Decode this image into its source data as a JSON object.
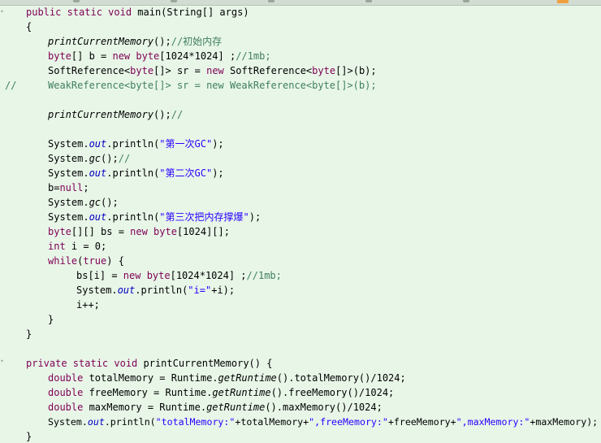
{
  "lines": [
    {
      "text": "public static void main(String[] args)"
    },
    {
      "text": "{"
    },
    {
      "text": "printCurrentMemory();//初始内存"
    },
    {
      "text": "byte[] b = new byte[1024*1024] ;//1mb;"
    },
    {
      "text": "SoftReference<byte[]> sr = new SoftReference<byte[]>(b);"
    },
    {
      "text": "WeakReference<byte[]> sr = new WeakReference<byte[]>(b);"
    },
    {
      "text": ""
    },
    {
      "text": "printCurrentMemory();//"
    },
    {
      "text": ""
    },
    {
      "text": "System.out.println(\"第一次GC\");"
    },
    {
      "text": "System.gc();//"
    },
    {
      "text": "System.out.println(\"第二次GC\");"
    },
    {
      "text": "b=null;"
    },
    {
      "text": "System.gc();"
    },
    {
      "text": "System.out.println(\"第三次把内存撑爆\");"
    },
    {
      "text": "byte[][] bs = new byte[1024][];"
    },
    {
      "text": "int i = 0;"
    },
    {
      "text": "while(true) {"
    },
    {
      "text": "bs[i] = new byte[1024*1024] ;//1mb;"
    },
    {
      "text": "System.out.println(\"i=\"+i);"
    },
    {
      "text": "i++;"
    },
    {
      "text": "}"
    },
    {
      "text": "}"
    },
    {
      "text": ""
    },
    {
      "text": "private static void printCurrentMemory() {"
    },
    {
      "text": "double totalMemory = Runtime.getRuntime().totalMemory()/1024;"
    },
    {
      "text": "double freeMemory = Runtime.getRuntime().freeMemory()/1024;"
    },
    {
      "text": "double maxMemory = Runtime.getRuntime().maxMemory()/1024;"
    },
    {
      "text": "System.out.println(\"totalMemory:\"+totalMemory+\",freeMemory:\"+freeMemory+\",maxMemory:\"+maxMemory);"
    },
    {
      "text": "}"
    }
  ],
  "comment_marker": "//",
  "colors": {
    "background": "#e8f6e8",
    "keyword": "#7f0055",
    "string": "#2a00ff",
    "comment": "#3f7f5f",
    "static_field": "#0000c0"
  }
}
